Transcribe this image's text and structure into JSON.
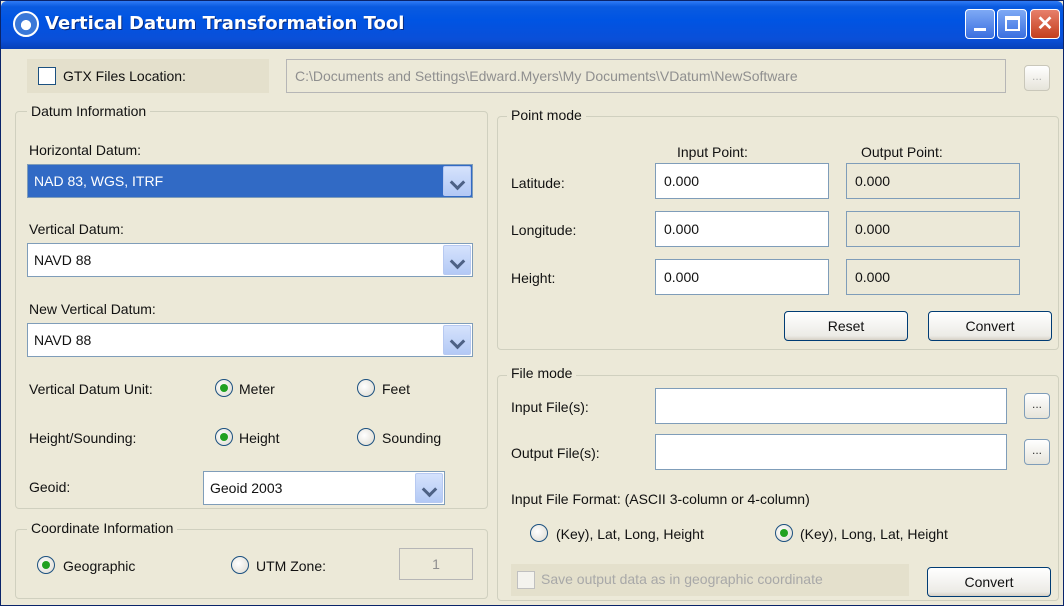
{
  "window": {
    "title": "Vertical Datum Transformation Tool"
  },
  "gtx": {
    "label": "GTX Files Location:",
    "path": "C:\\Documents and Settings\\Edward.Myers\\My Documents\\VDatum\\NewSoftware",
    "browse": "..."
  },
  "datum": {
    "legend": "Datum Information",
    "horizontal_label": "Horizontal Datum:",
    "horizontal_value": "NAD 83, WGS, ITRF",
    "vertical_label": "Vertical Datum:",
    "vertical_value": "NAVD 88",
    "new_vertical_label": "New Vertical Datum:",
    "new_vertical_value": "NAVD 88",
    "unit_label": "Vertical Datum Unit:",
    "unit_meter": "Meter",
    "unit_feet": "Feet",
    "hs_label": "Height/Sounding:",
    "hs_height": "Height",
    "hs_sounding": "Sounding",
    "geoid_label": "Geoid:",
    "geoid_value": "Geoid 2003"
  },
  "coord": {
    "legend": "Coordinate Information",
    "geographic": "Geographic",
    "utm": "UTM Zone:",
    "utm_value": "1"
  },
  "point": {
    "legend": "Point mode",
    "input_header": "Input Point:",
    "output_header": "Output Point:",
    "lat_label": "Latitude:",
    "lon_label": "Longitude:",
    "height_label": "Height:",
    "lat_in": "0.000",
    "lat_out": "0.000",
    "lon_in": "0.000",
    "lon_out": "0.000",
    "h_in": "0.000",
    "h_out": "0.000",
    "reset": "Reset",
    "convert": "Convert"
  },
  "file": {
    "legend": "File mode",
    "input_label": "Input File(s):",
    "output_label": "Output File(s):",
    "browse": "...",
    "format_label": "Input File Format: (ASCII 3-column or 4-column)",
    "opt_latlong": "(Key), Lat, Long, Height",
    "opt_longlat": "(Key), Long, Lat, Height",
    "save_geo": "Save output data as in geographic coordinate",
    "convert": "Convert"
  }
}
